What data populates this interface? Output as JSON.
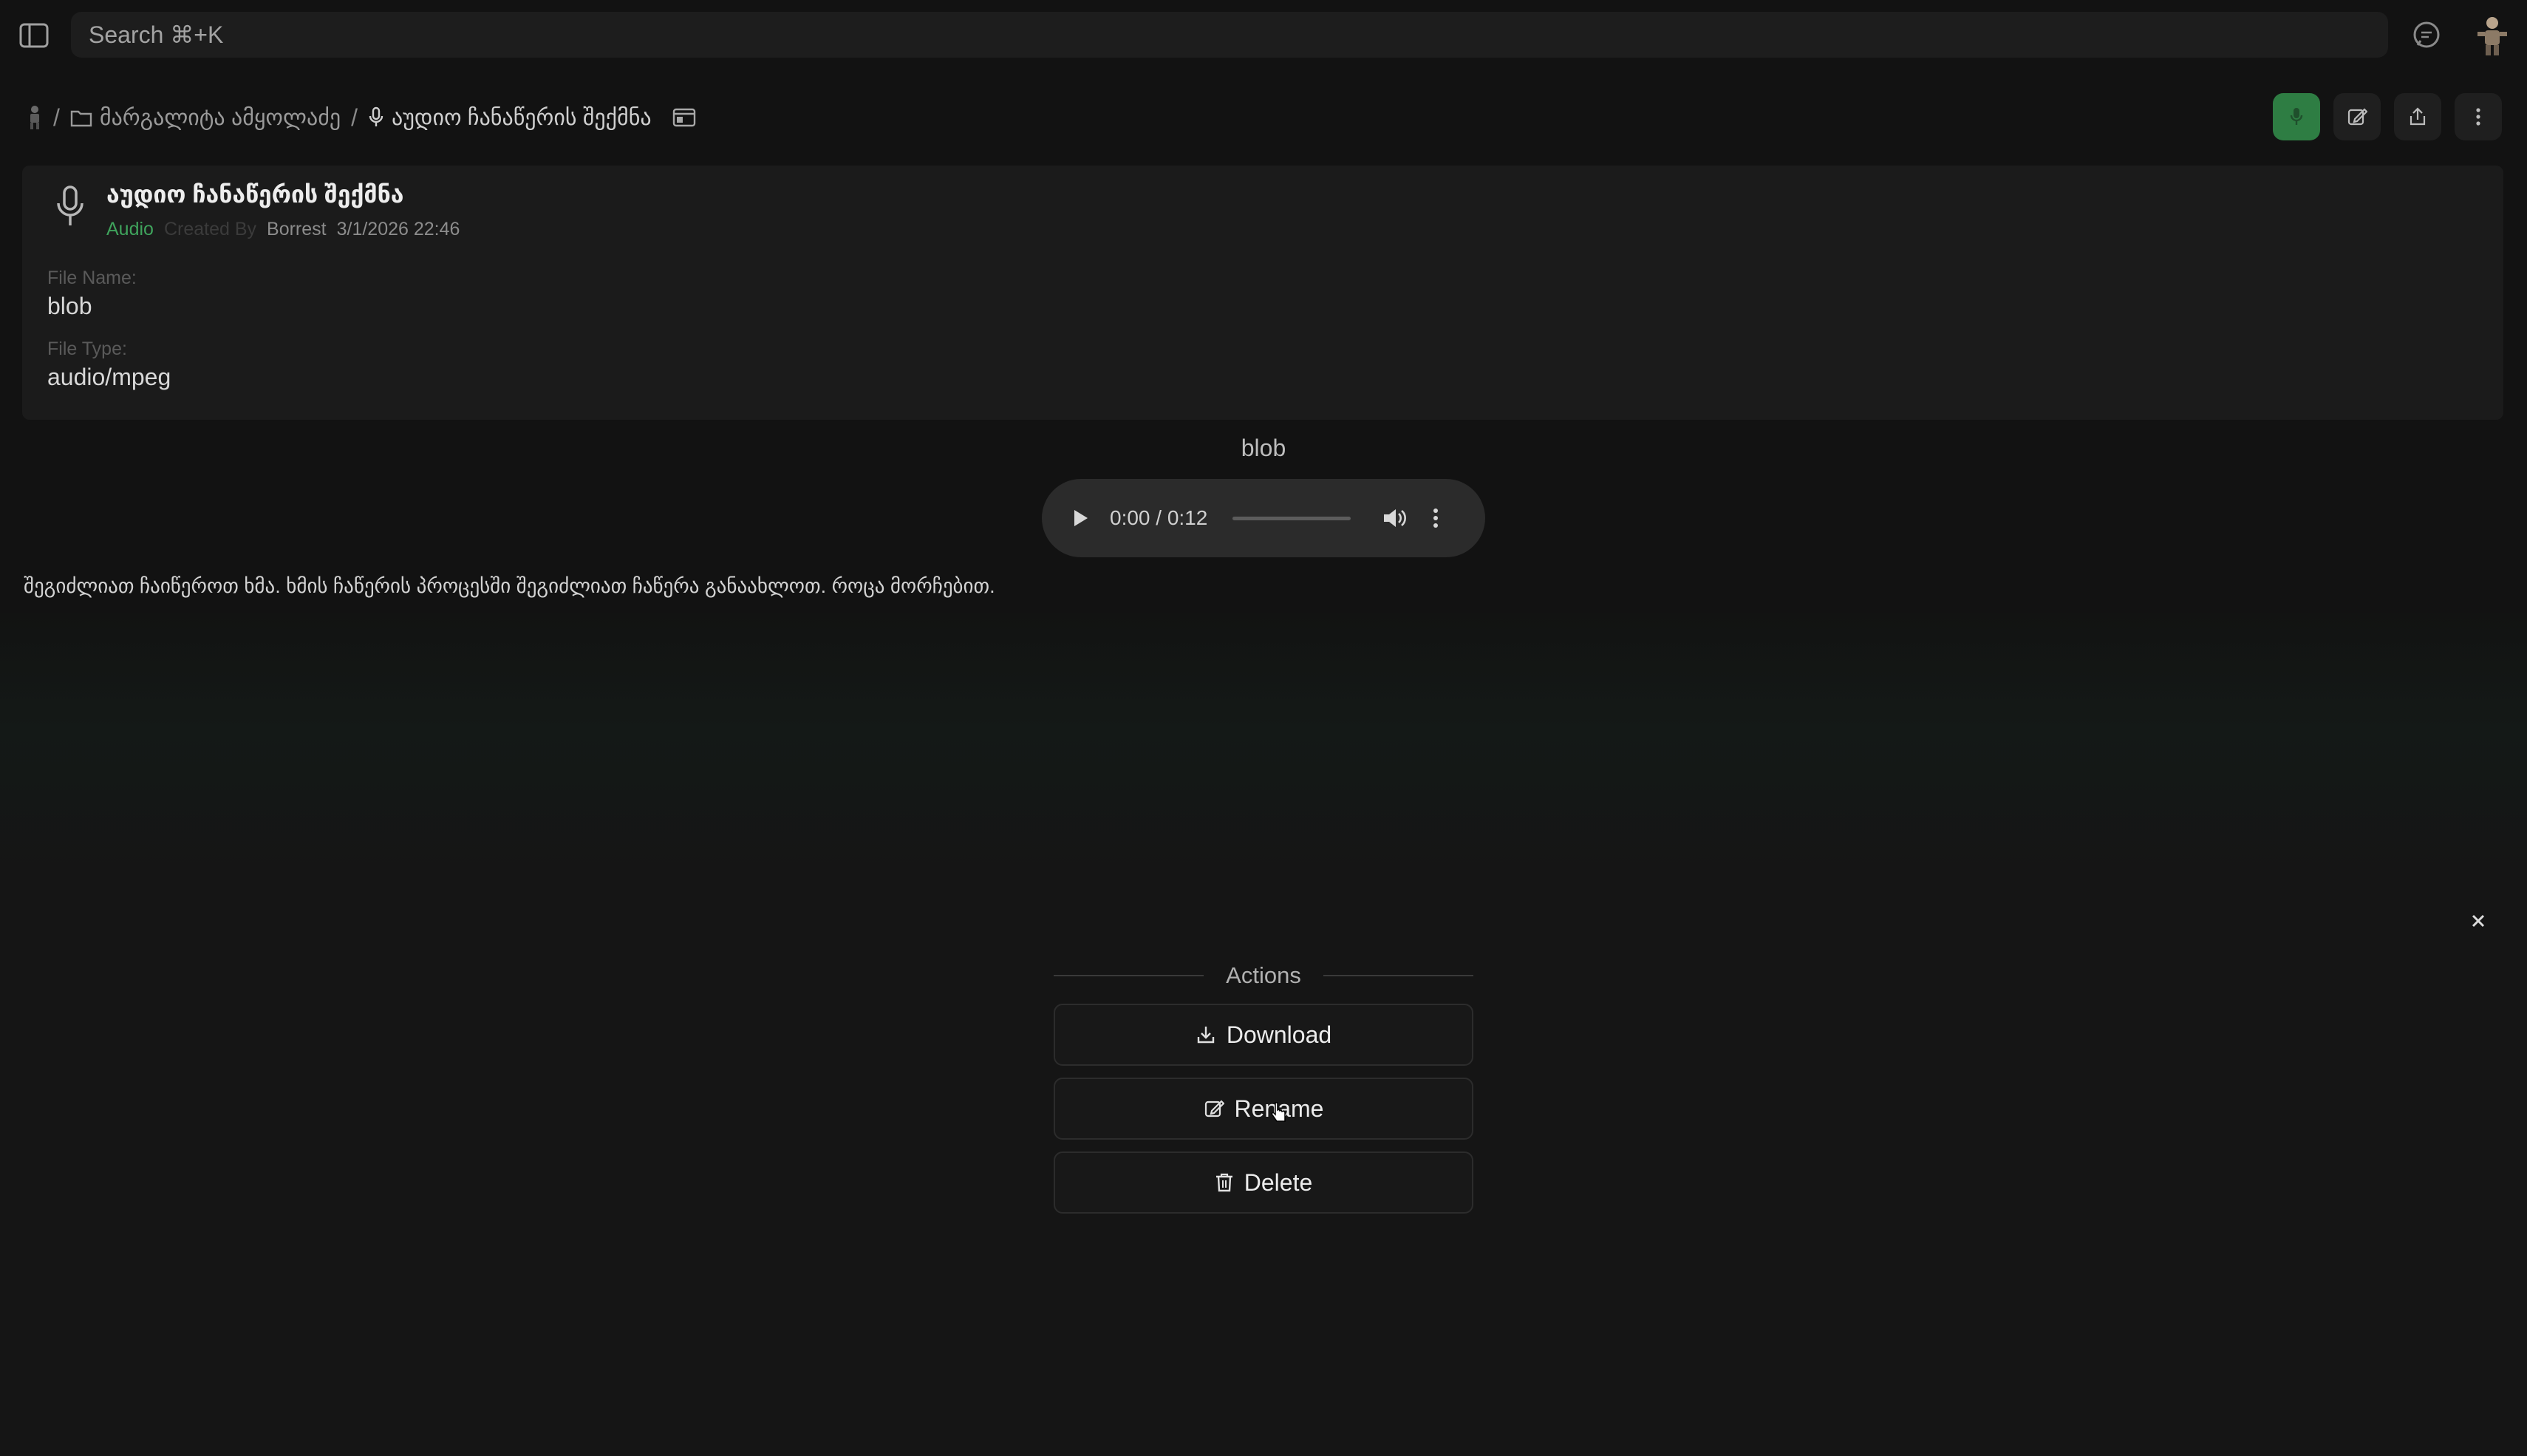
{
  "topbar": {
    "search_placeholder": "Search ⌘+K"
  },
  "breadcrumb": {
    "folder": "მარგალიტა ამყოლაძე",
    "current": "აუდიო ჩანაწერის შექმნა",
    "separator": "/"
  },
  "card": {
    "title": "აუდიო ჩანაწერის შექმნა",
    "kind": "Audio",
    "created_by_label": "Created By",
    "author": "Borrest",
    "date": "3/1/2026 22:46",
    "file_name_label": "File Name:",
    "file_name": "blob",
    "file_type_label": "File Type:",
    "file_type": "audio/mpeg"
  },
  "audio": {
    "caption": "blob",
    "time": "0:00 / 0:12"
  },
  "description": "შეგიძლიათ ჩაიწეროთ ხმა. ხმის ჩაწერის პროცესში შეგიძლიათ ჩაწერა განაახლოთ. როცა მორჩებით.",
  "actions": {
    "title": "Actions",
    "download": "Download",
    "rename": "Rename",
    "delete": "Delete"
  },
  "colors": {
    "accent_green": "#2e7d43",
    "kind_green": "#3fa35c"
  }
}
